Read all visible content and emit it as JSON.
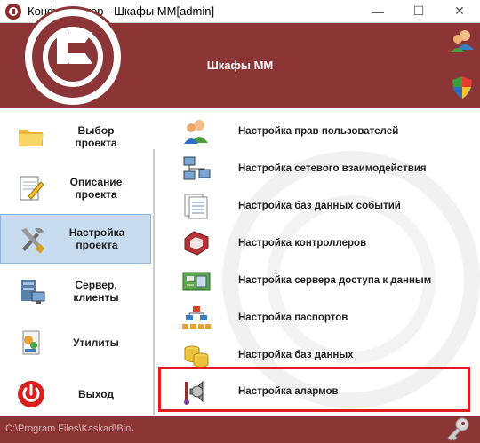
{
  "window": {
    "title": "Конфигуратор - Шкафы ММ[admin]",
    "controls": [
      "—",
      "☐",
      "✕"
    ]
  },
  "header": {
    "title": "Шкафы ММ",
    "icons": [
      "users-icon",
      "shield-icon"
    ]
  },
  "sidebar": {
    "items": [
      {
        "label": "Выбор проекта",
        "icon": "folder-icon"
      },
      {
        "label": "Описание проекта",
        "icon": "notepad-pencil-icon"
      },
      {
        "label": "Настройка проекта",
        "icon": "tools-icon",
        "active": true
      },
      {
        "label": "Сервер, клиенты",
        "icon": "server-icon"
      },
      {
        "label": "Утилиты",
        "icon": "utilities-icon"
      },
      {
        "label": "Выход",
        "icon": "power-icon"
      }
    ]
  },
  "main": {
    "items": [
      {
        "label": "Настройка прав пользователей",
        "icon": "users-icon"
      },
      {
        "label": "Настройка сетевого взаимодействия",
        "icon": "network-icon"
      },
      {
        "label": "Настройка баз данных событий",
        "icon": "documents-icon"
      },
      {
        "label": "Настройка контроллеров",
        "icon": "controller-icon"
      },
      {
        "label": "Настройка сервера доступа к данным",
        "icon": "server-board-icon"
      },
      {
        "label": "Настройка паспортов",
        "icon": "hierarchy-icon"
      },
      {
        "label": "Настройка баз данных",
        "icon": "database-icon"
      },
      {
        "label": "Настройка алармов",
        "icon": "alarm-speaker-icon",
        "highlighted": true
      }
    ]
  },
  "status": {
    "path": "C:\\Program Files\\Kaskad\\Bin\\"
  },
  "colors": {
    "brand": "#8b3536",
    "active_bg": "#c8dcf0",
    "highlight_border": "#e02020"
  }
}
